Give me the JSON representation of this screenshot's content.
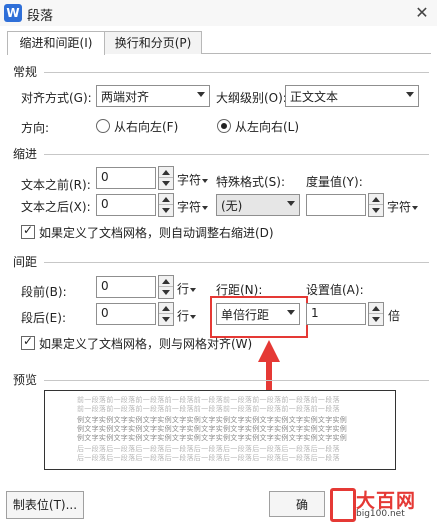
{
  "window": {
    "title": "段落",
    "close_icon": "close-icon"
  },
  "tabs": [
    {
      "label": "缩进和间距(I)",
      "active": true
    },
    {
      "label": "换行和分页(P)",
      "active": false
    }
  ],
  "general": {
    "section_title": "常规",
    "alignment_label": "对齐方式(G):",
    "alignment_value": "两端对齐",
    "outline_label": "大纲级别(O):",
    "outline_value": "正文文本",
    "direction_label": "方向:",
    "rtl_label": "从右向左(F)",
    "ltr_label": "从左向右(L)",
    "direction_selected": "ltr"
  },
  "indent": {
    "section_title": "缩进",
    "before_label": "文本之前(R):",
    "before_value": "0",
    "before_unit": "字符",
    "after_label": "文本之后(X):",
    "after_value": "0",
    "after_unit": "字符",
    "special_label": "特殊格式(S):",
    "special_value": "(无)",
    "measure_label": "度量值(Y):",
    "measure_value": "",
    "measure_unit": "字符",
    "auto_adjust_label": "如果定义了文档网格，则自动调整右缩进(D)",
    "auto_adjust_checked": true
  },
  "spacing": {
    "section_title": "间距",
    "before_label": "段前(B):",
    "before_value": "0",
    "before_unit": "行",
    "after_label": "段后(E):",
    "after_value": "0",
    "after_unit": "行",
    "line_label": "行距(N):",
    "line_value": "单倍行距",
    "setting_label": "设置值(A):",
    "setting_value": "1",
    "setting_unit": "倍",
    "snap_grid_label": "如果定义了文档网格，则与网格对齐(W)",
    "snap_grid_checked": true
  },
  "preview": {
    "section_title": "预览",
    "prev_line": "前一段落前一段落前一段落前一段落前一段落前一段落前一段落前一段落前一段落",
    "sample_line": "例文字实例文字实例文字实例文字实例文字实例文字实例文字实例文字实例文字实例",
    "next_line": "后一段落后一段落后一段落后一段落后一段落后一段落后一段落后一段落后一段落"
  },
  "buttons": {
    "tabs_label": "制表位(T)...",
    "ok_label": "确"
  },
  "watermark": {
    "brand": "大百网",
    "url": "big100.net"
  },
  "colors": {
    "highlight": "#e53935",
    "app_icon": "#2f6fd8"
  }
}
